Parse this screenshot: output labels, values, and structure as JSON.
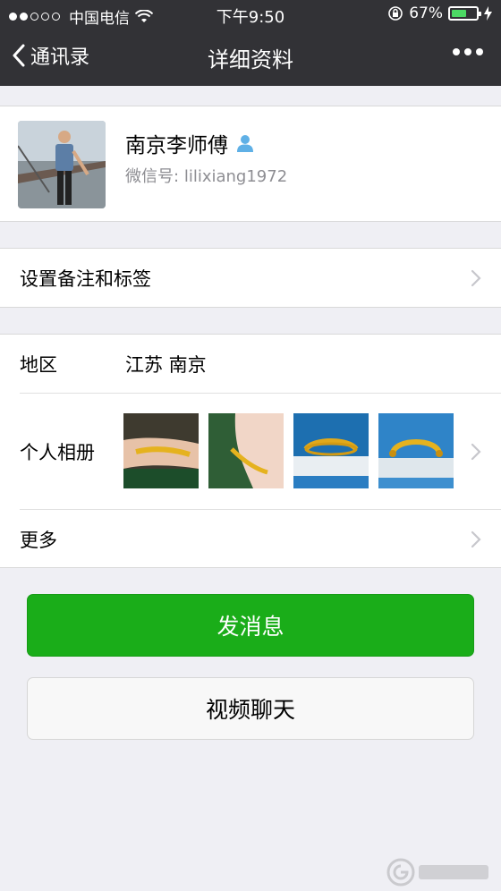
{
  "status_bar": {
    "carrier": "中国电信",
    "time": "下午9:50",
    "battery_percent": "67%",
    "battery_level": 0.67
  },
  "nav": {
    "back_label": "通讯录",
    "title": "详细资料"
  },
  "profile": {
    "name": "南京李师傅",
    "wechat_id_label": "微信号:",
    "wechat_id": "lilixiang1972"
  },
  "remark": {
    "label": "设置备注和标签"
  },
  "info": {
    "region_label": "地区",
    "region_value": "江苏 南京",
    "album_label": "个人相册",
    "more_label": "更多"
  },
  "actions": {
    "send_message": "发消息",
    "video_call": "视频聊天"
  },
  "colors": {
    "nav_bg": "#323236",
    "primary_green": "#1aad19",
    "page_bg": "#efeff4"
  }
}
